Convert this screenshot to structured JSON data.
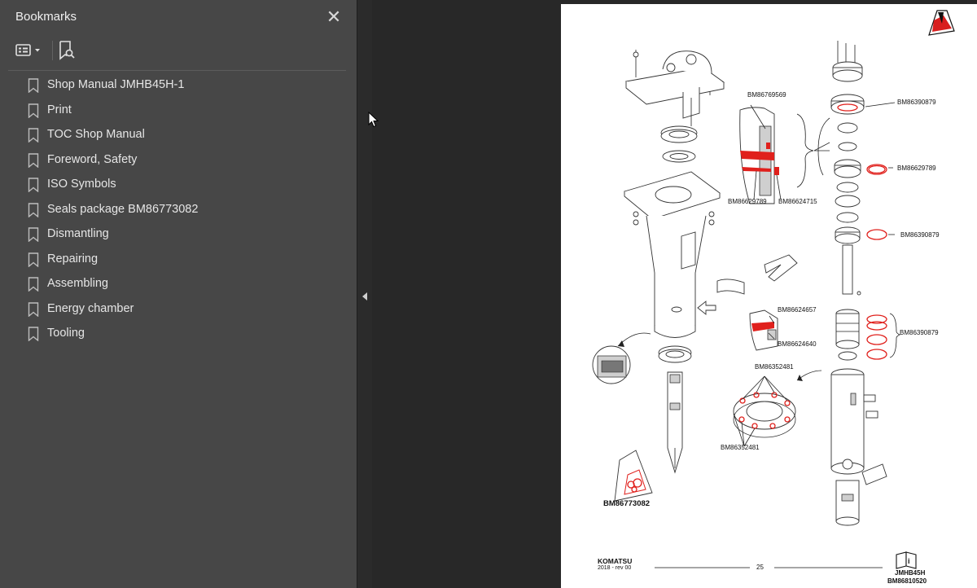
{
  "bookmarks_panel": {
    "title": "Bookmarks",
    "close_label": "✕",
    "items": [
      {
        "label": "Shop Manual JMHB45H-1"
      },
      {
        "label": "Print"
      },
      {
        "label": "TOC Shop Manual"
      },
      {
        "label": "Foreword, Safety"
      },
      {
        "label": "ISO Symbols"
      },
      {
        "label": "Seals package BM86773082"
      },
      {
        "label": "Dismantling"
      },
      {
        "label": "Repairing"
      },
      {
        "label": "Assembling"
      },
      {
        "label": "Energy chamber"
      },
      {
        "label": "Tooling"
      }
    ]
  },
  "page": {
    "part_labels": {
      "bm86769569": "BM86769569",
      "bm86629789_left": "BM86629789",
      "bm86624715": "BM86624715",
      "bm86390879_top": "BM86390879",
      "bm86629789_right": "BM86629789",
      "bm86390879_mid": "BM86390879",
      "bm86624657": "BM86624657",
      "bm86624640": "BM86624640",
      "bm86390879_bottom": "BM86390879",
      "bm86352481_top": "BM86352481",
      "bm86352481_bottom": "BM86352481",
      "seal_package": "BM86773082"
    },
    "footer": {
      "brand": "KOMATSU",
      "revision": "2018 -  rev 00",
      "page_number": "25",
      "model": "JMHB45H",
      "document_code": "BM86810520"
    }
  },
  "colors": {
    "panel_bg": "#474747",
    "app_bg": "#282828",
    "highlight_red": "#e0201c"
  }
}
